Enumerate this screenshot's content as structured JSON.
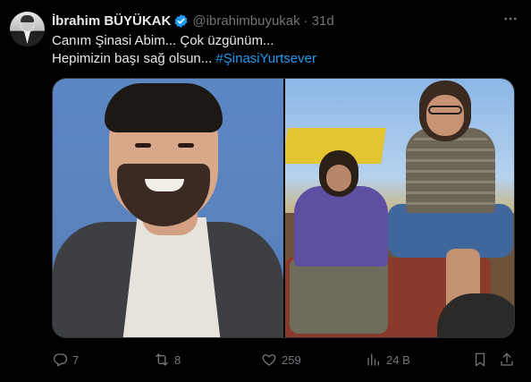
{
  "author": {
    "name": "İbrahim BÜYÜKAK",
    "handle": "@ibrahimbuyukak",
    "separator": "·",
    "time": "31d",
    "verified": true
  },
  "tweet": {
    "line1": "Canım Şinasi Abim... Çok üzgünüm...",
    "line2_text": "Hepimizin başı sağ olsun... ",
    "hashtag": "#ŞinasiYurtsever"
  },
  "actions": {
    "replies": "7",
    "reposts": "8",
    "likes": "259",
    "views": "24 B"
  },
  "icons": {
    "reply": "reply-icon",
    "repost": "repost-icon",
    "like": "heart-icon",
    "views": "views-icon",
    "bookmark": "bookmark-icon",
    "share": "share-icon",
    "more": "more-icon",
    "verified": "verified-badge-icon"
  },
  "colors": {
    "background": "#000000",
    "text": "#e7e9ea",
    "muted": "#71767b",
    "accent": "#1d9bf0"
  }
}
